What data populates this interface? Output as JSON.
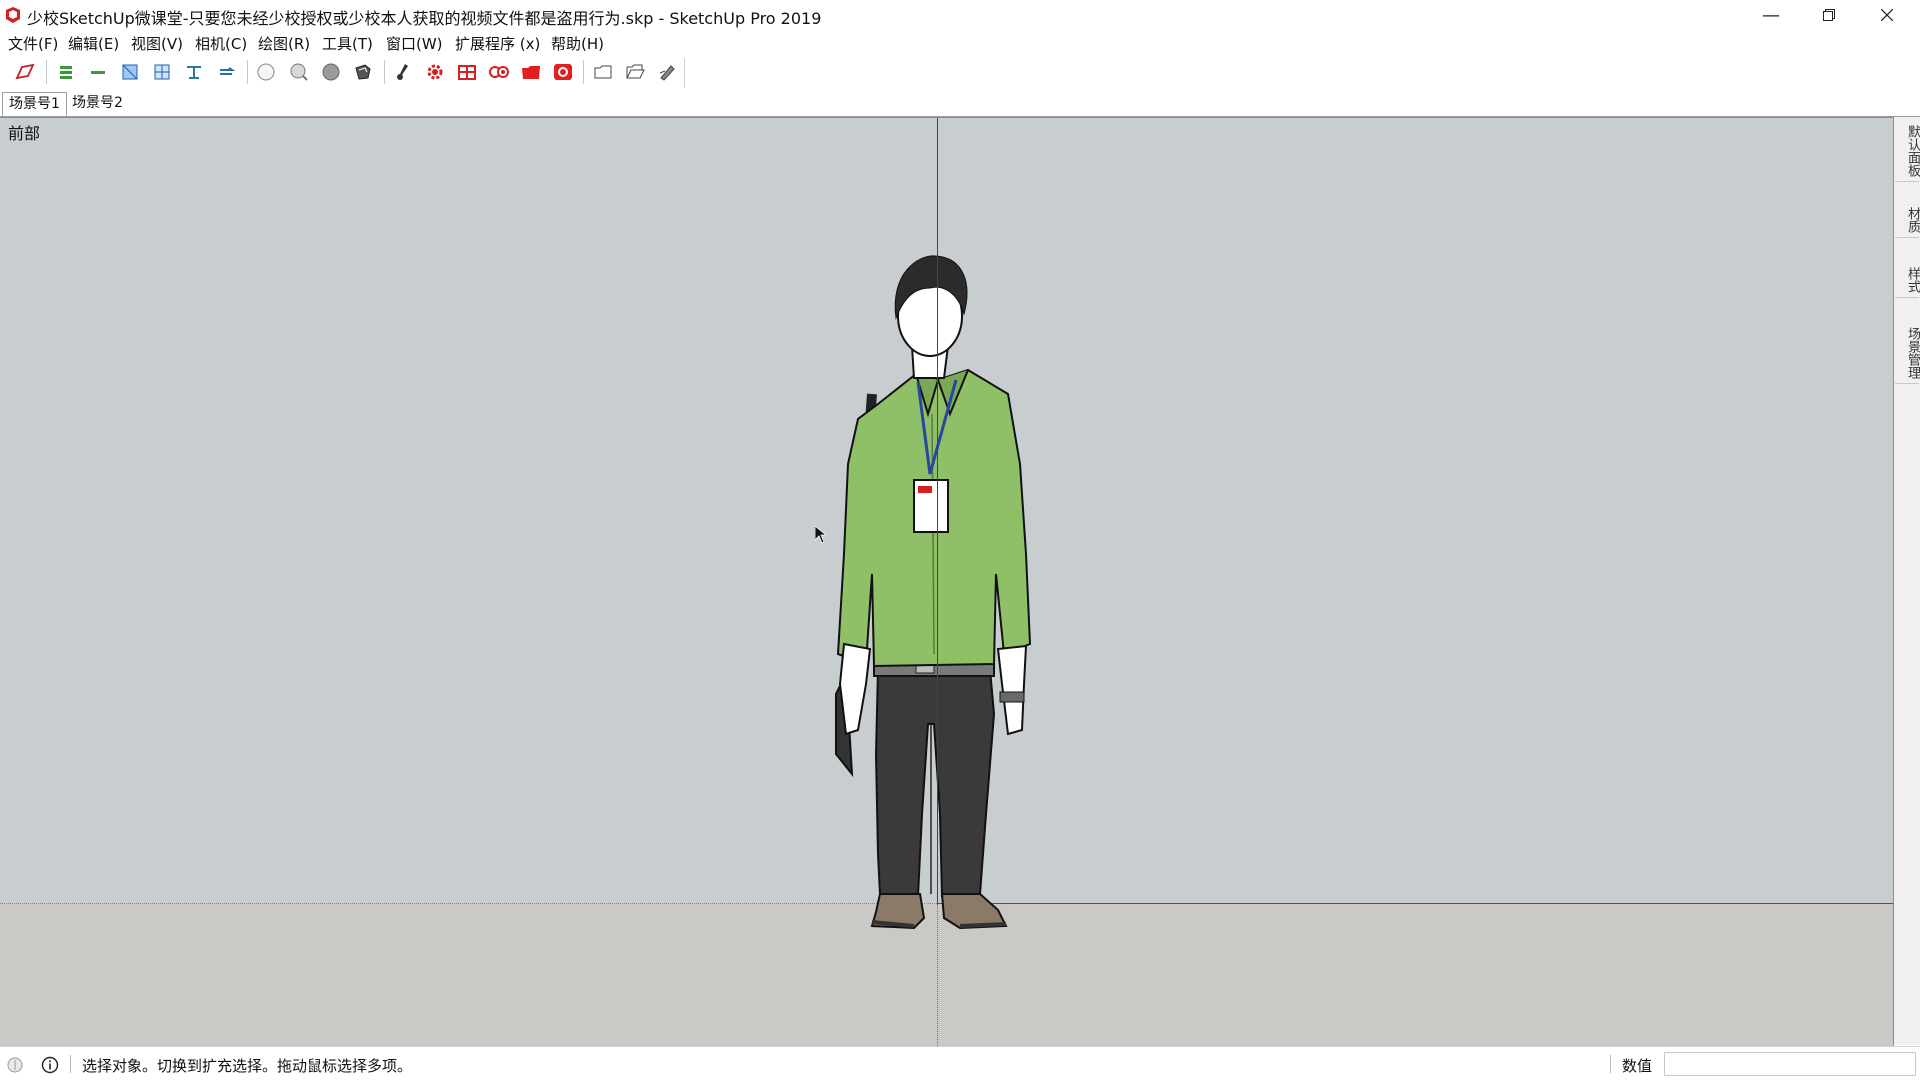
{
  "window": {
    "title": "少校SketchUp微课堂-只要您未经少校授权或少校本人获取的视频文件都是盗用行为.skp - SketchUp Pro 2019",
    "controls": [
      "minimize-icon",
      "restore-icon",
      "close-icon"
    ]
  },
  "menu": {
    "items": [
      {
        "label": "文件(F)"
      },
      {
        "label": "编辑(E)"
      },
      {
        "label": "视图(V)"
      },
      {
        "label": "相机(C)"
      },
      {
        "label": "绘图(R)"
      },
      {
        "label": "工具(T)"
      },
      {
        "label": "窗口(W)"
      },
      {
        "label": "扩展程序 (x)"
      },
      {
        "label": "帮助(H)"
      }
    ]
  },
  "toolbar": {
    "groups": [
      [
        "select-edge-icon"
      ],
      [
        "xray-icon",
        "back-edges-icon",
        "wireframe-icon",
        "hidden-line-icon",
        "shaded-icon",
        "shaded-textures-icon"
      ],
      [
        "iso-view-icon",
        "top-view-icon",
        "front-view-icon",
        "right-view-icon"
      ],
      [
        "paint-icon",
        "settings-gear-icon",
        "table-grid-icon",
        "camera-pair-icon",
        "red-folder-icon",
        "red-record-icon"
      ],
      [
        "folder-icon",
        "open-folder-icon",
        "pen-icon"
      ]
    ]
  },
  "scenes": {
    "tabs": [
      {
        "label": "场景号1",
        "active": true
      },
      {
        "label": "场景号2",
        "active": false
      }
    ]
  },
  "viewport": {
    "view_label": "前部",
    "colors": {
      "sky": "#c8cdd0",
      "ground": "#cac9c6",
      "blue_axis": "#3434c8",
      "red_axis": "#c82020"
    }
  },
  "tray": {
    "tabs": [
      {
        "label": "默认面板"
      },
      {
        "label": "材质"
      },
      {
        "label": "样式"
      },
      {
        "label": "场景管理"
      }
    ]
  },
  "status": {
    "text": "选择对象。切换到扩充选择。拖动鼠标选择多项。",
    "measurements_label": "数值",
    "measurements_value": ""
  }
}
